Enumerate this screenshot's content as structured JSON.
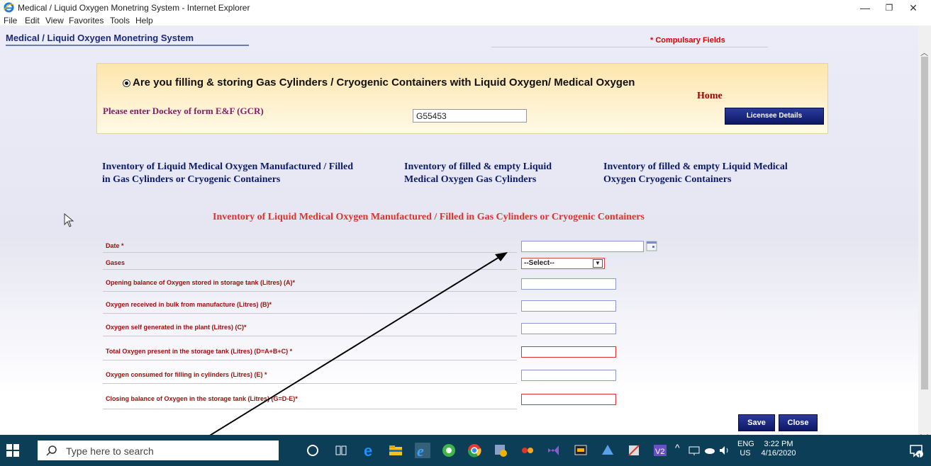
{
  "window": {
    "title": "Medical / Liquid Oxygen Monetring System - Internet Explorer",
    "menu": [
      "File",
      "Edit",
      "View",
      "Favorites",
      "Tools",
      "Help"
    ],
    "minimize": "—",
    "restore": "❐",
    "close": "✕"
  },
  "page": {
    "app_title": "Medical / Liquid Oxygen Monetring System",
    "compulsory_note": "* Compulsary Fields",
    "question": "Are you filling & storing Gas Cylinders / Cryogenic Containers with Liquid Oxygen/ Medical Oxygen",
    "question_selected": true,
    "home_link": "Home",
    "dockey_label": "Please enter Dockey of form E&F (GCR)",
    "dockey_value": "G55453",
    "licensee_button": "Licensee Details",
    "inventory_links": [
      {
        "line1": "Inventory of Liquid Medical Oxygen Manufactured / Filled",
        "line2": "in Gas Cylinders or Cryogenic Containers"
      },
      {
        "line1": "Inventory of filled & empty Liquid",
        "line2": "Medical Oxygen Gas Cylinders"
      },
      {
        "line1": "Inventory of filled & empty Liquid Medical",
        "line2": "Oxygen Cryogenic Containers"
      }
    ],
    "section_title": "Inventory of Liquid Medical Oxygen Manufactured / Filled in Gas Cylinders or Cryogenic Containers"
  },
  "form": {
    "date_label": "Date *",
    "gases_label": "Gases",
    "gases_selected": "--Select--",
    "fields": [
      {
        "label": "Opening balance of Oxygen stored in storage tank (Litres) (A)*",
        "value": "",
        "required_highlight": false
      },
      {
        "label": "Oxygen received in bulk from manufacture (Litres) (B)*",
        "value": "",
        "required_highlight": false
      },
      {
        "label": "Oxygen self generated in the plant (Litres) (C)*",
        "value": "",
        "required_highlight": false
      },
      {
        "label": "Total Oxygen present in the storage tank (Litres) (D=A+B+C) *",
        "value": "",
        "required_highlight": true
      },
      {
        "label": "Oxygen consumed for filling in cylinders (Litres) (E) *",
        "value": "",
        "required_highlight": false
      },
      {
        "label": "Closing balance of Oxygen in the storage tank (Litres) (G=D-E)*",
        "value": "",
        "required_highlight": true
      }
    ],
    "save_button": "Save",
    "close_button": "Close"
  },
  "taskbar": {
    "search_placeholder": "Type here to search",
    "lang_top": "ENG",
    "lang_bottom": "US",
    "time": "3:22 PM",
    "date": "4/16/2020",
    "notification_count": "1"
  },
  "colors": {
    "accent_blue": "#0d1864",
    "label_red": "#a01010",
    "title_red": "#e03030",
    "taskbar": "#0d3e57"
  }
}
